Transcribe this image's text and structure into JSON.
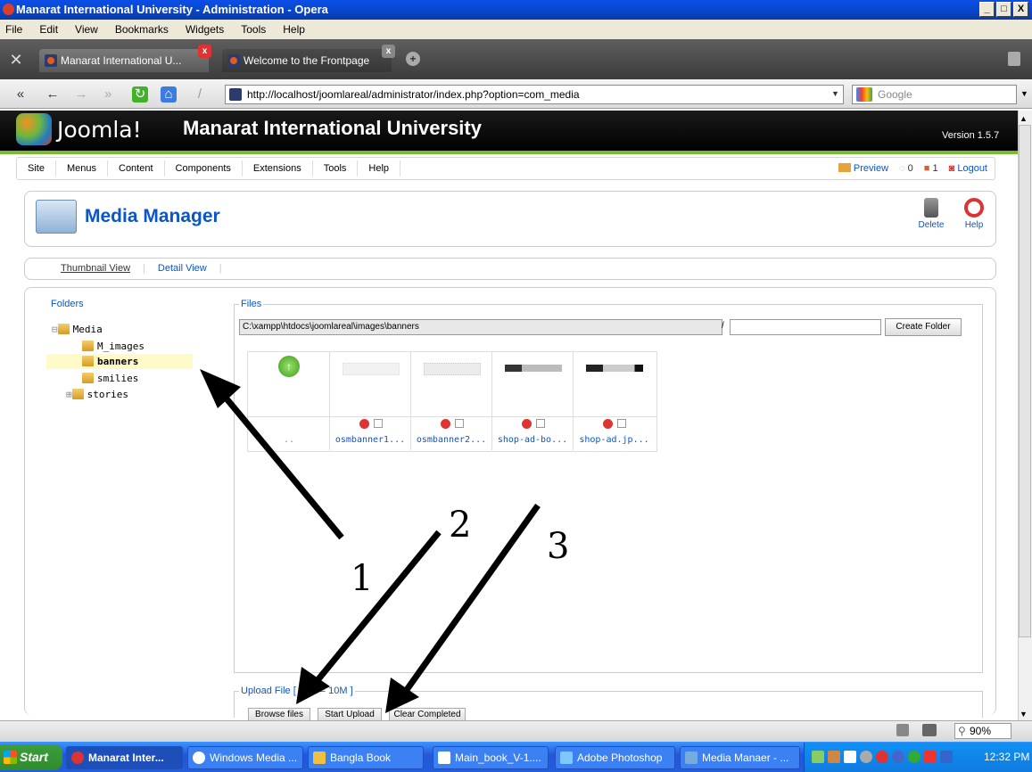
{
  "window": {
    "title": "Manarat International University - Administration - Opera",
    "min": "_",
    "max": "□",
    "close": "X"
  },
  "menubar": [
    "File",
    "Edit",
    "View",
    "Bookmarks",
    "Widgets",
    "Tools",
    "Help"
  ],
  "tabs": [
    {
      "label": "Manarat International U..."
    },
    {
      "label": "Welcome to the Frontpage"
    }
  ],
  "addressbar": {
    "url": "http://localhost/joomlareal/administrator/index.php?option=com_media",
    "search_placeholder": "Google"
  },
  "joomla": {
    "logo": "Joomla!",
    "site_title": "Manarat International University",
    "version": "Version 1.5.7",
    "menu": [
      "Site",
      "Menus",
      "Content",
      "Components",
      "Extensions",
      "Tools",
      "Help"
    ],
    "right": {
      "preview": "Preview",
      "messages": "0",
      "users": "1",
      "logout": "Logout"
    }
  },
  "toolbar": {
    "title": "Media Manager",
    "delete": "Delete",
    "help": "Help"
  },
  "views": {
    "thumbnail": "Thumbnail View",
    "detail": "Detail View"
  },
  "folders": {
    "legend": "Folders",
    "items": [
      "Media",
      "M_images",
      "banners",
      "smilies",
      "stories"
    ]
  },
  "files": {
    "legend": "Files",
    "path": "C:\\xampp\\htdocs\\joomlareal\\images\\banners",
    "separator": "/",
    "create_folder": "Create Folder",
    "up_label": "..",
    "items": [
      "osmbanner1...",
      "osmbanner2...",
      "shop-ad-bo...",
      "shop-ad.jp..."
    ]
  },
  "upload": {
    "legend": "Upload File [ Max = 10M ]",
    "browse": "Browse files",
    "start": "Start Upload",
    "clear": "Clear Completed"
  },
  "annotations": [
    "1",
    "2",
    "3"
  ],
  "statusbar": {
    "zoom": "90%"
  },
  "taskbar": {
    "start": "Start",
    "tasks": [
      "Manarat Inter...",
      "Windows Media ...",
      "Bangla Book",
      "Main_book_V-1....",
      "Adobe Photoshop",
      "Media Manaer - ..."
    ],
    "clock": "12:32 PM"
  }
}
